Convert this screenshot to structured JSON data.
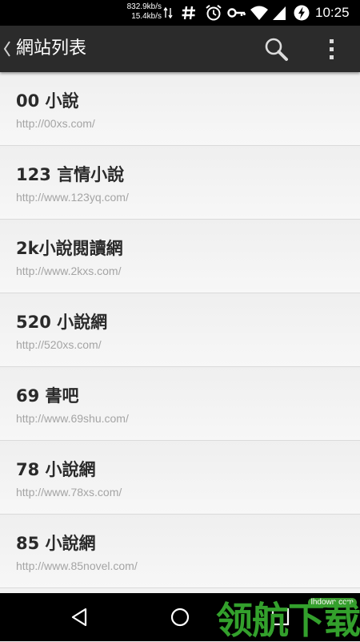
{
  "status_bar": {
    "download_speed": "832.9kb/s",
    "upload_speed": "15.4kb/s",
    "time": "10:25",
    "icons": [
      "data-transfer-icon",
      "hash-icon",
      "alarm-icon",
      "vpn-key-icon",
      "wifi-icon",
      "cell-signal-icon",
      "battery-saver-icon"
    ]
  },
  "action_bar": {
    "title": "網站列表",
    "icons": [
      "back-chevron-icon",
      "search-icon",
      "overflow-menu-icon"
    ]
  },
  "sites": [
    {
      "name": "00 小說",
      "url": "http://00xs.com/"
    },
    {
      "name": "123 言情小說",
      "url": "http://www.123yq.com/"
    },
    {
      "name": "2k小說閱讀網",
      "url": "http://www.2kxs.com/"
    },
    {
      "name": "520 小說網",
      "url": "http://520xs.com/"
    },
    {
      "name": "69 書吧",
      "url": "http://www.69shu.com/"
    },
    {
      "name": "78 小說網",
      "url": "http://www.78xs.com/"
    },
    {
      "name": "85 小說網",
      "url": "http://www.85novel.com/"
    }
  ],
  "nav_bar": {
    "icons": [
      "back-icon",
      "home-icon",
      "recents-icon"
    ]
  },
  "watermark": {
    "text": "领航下载",
    "domain": "lhdown.com",
    "color": "#33a02c"
  }
}
